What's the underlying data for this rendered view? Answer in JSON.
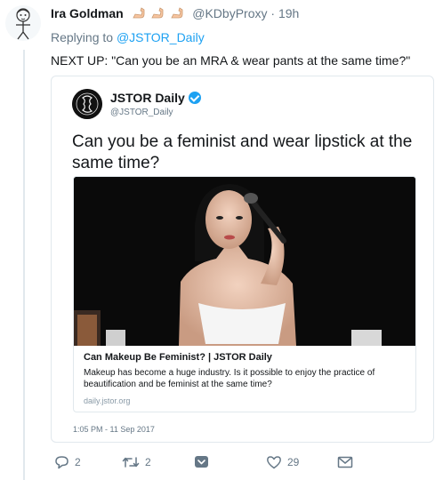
{
  "tweet": {
    "author_name": "Ira Goldman",
    "handle": "@KDbyProxy",
    "separator": "·",
    "time": "19h",
    "replying_prefix": "Replying to ",
    "replying_to": "@JSTOR_Daily",
    "text": "NEXT UP: \"Can you be an MRA & wear pants at the same time?\""
  },
  "quote": {
    "name": "JSTOR Daily",
    "handle": "@JSTOR_Daily",
    "text": "Can you be a feminist and wear lipstick at the same time?",
    "card": {
      "title": "Can Makeup Be Feminist? | JSTOR Daily",
      "description": "Makeup has become a huge industry. Is it possible to enjoy the practice of beautification and be feminist at the same time?",
      "domain": "daily.jstor.org"
    },
    "timestamp": "1:05 PM - 11 Sep 2017"
  },
  "actions": {
    "reply_count": "2",
    "retweet_count": "2",
    "like_count": "29"
  },
  "colors": {
    "link": "#1da1f2",
    "muted": "#657786",
    "border": "#e1e8ed"
  }
}
